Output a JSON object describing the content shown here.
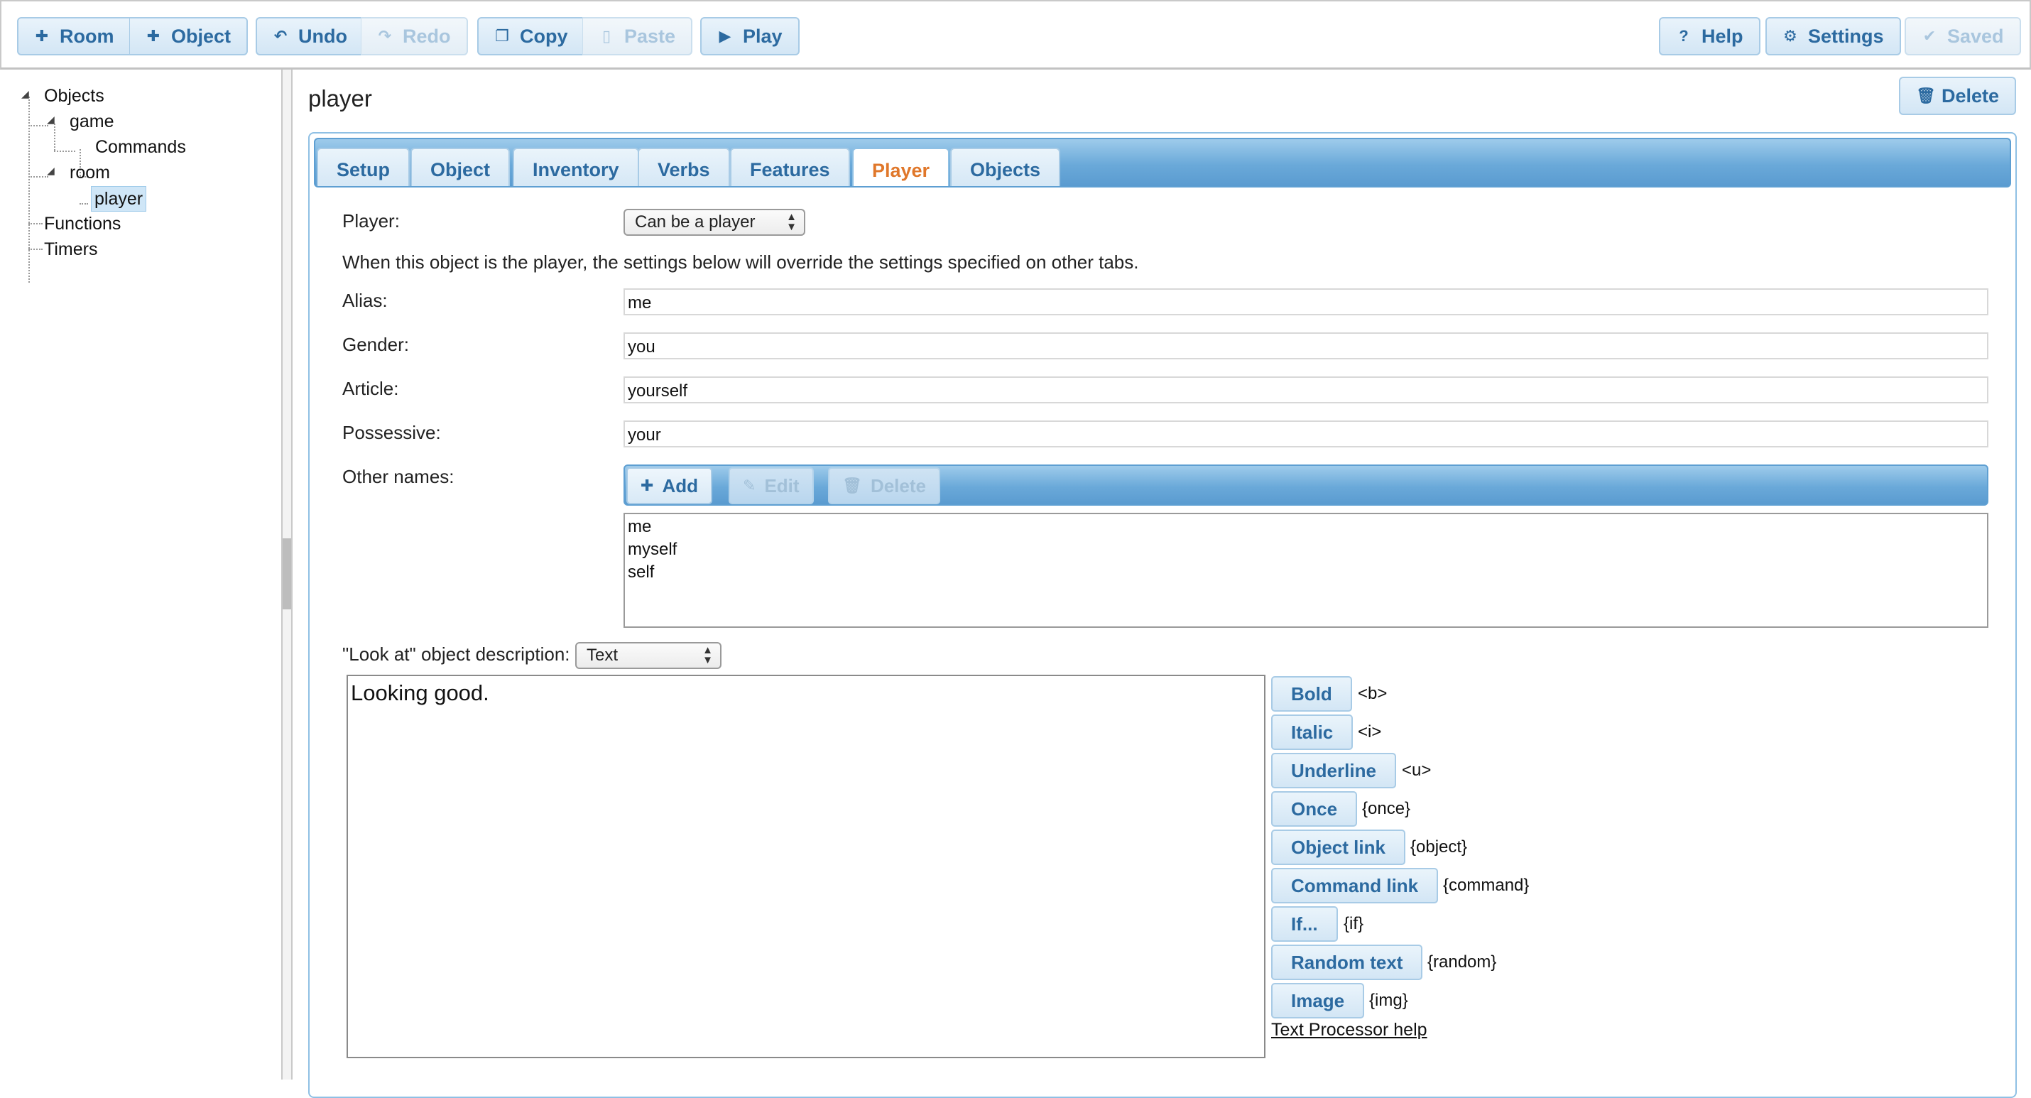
{
  "toolbar": {
    "room": "Room",
    "object": "Object",
    "undo": "Undo",
    "redo": "Redo",
    "copy": "Copy",
    "paste": "Paste",
    "play": "Play",
    "help": "Help",
    "settings": "Settings",
    "saved": "Saved"
  },
  "tree": {
    "objects": "Objects",
    "game": "game",
    "commands": "Commands",
    "room": "room",
    "player": "player",
    "functions": "Functions",
    "timers": "Timers"
  },
  "main": {
    "title": "player",
    "delete": "Delete",
    "tabs": [
      "Setup",
      "Object",
      "Inventory",
      "Verbs",
      "Features",
      "Player",
      "Objects"
    ],
    "active_tab": "Player"
  },
  "player_tab": {
    "player_label": "Player:",
    "player_select": "Can be a player",
    "note": "When this object is the player, the settings below will override the settings specified on other tabs.",
    "alias_label": "Alias:",
    "alias_value": "me",
    "gender_label": "Gender:",
    "gender_value": "you",
    "article_label": "Article:",
    "article_value": "yourself",
    "possessive_label": "Possessive:",
    "possessive_value": "your",
    "other_names_label": "Other names:",
    "add": "Add",
    "edit": "Edit",
    "delete": "Delete",
    "other_names": [
      "me",
      "myself",
      "self"
    ],
    "look_label": "\"Look at\" object description:",
    "look_select": "Text",
    "description_text": "Looking good."
  },
  "formatting": [
    {
      "label": "Bold",
      "tag": "<b>"
    },
    {
      "label": "Italic",
      "tag": "<i>"
    },
    {
      "label": "Underline",
      "tag": "<u>"
    },
    {
      "label": "Once",
      "tag": "{once}"
    },
    {
      "label": "Object link",
      "tag": "{object}"
    },
    {
      "label": "Command link",
      "tag": "{command}"
    },
    {
      "label": "If...",
      "tag": "{if}"
    },
    {
      "label": "Random text",
      "tag": "{random}"
    },
    {
      "label": "Image",
      "tag": "{img}"
    }
  ],
  "text_processor_help": "Text Processor help",
  "colors": {
    "accent": "#2c6aa0",
    "active_tab": "#e0772a",
    "bar": "#6aa9d9"
  }
}
